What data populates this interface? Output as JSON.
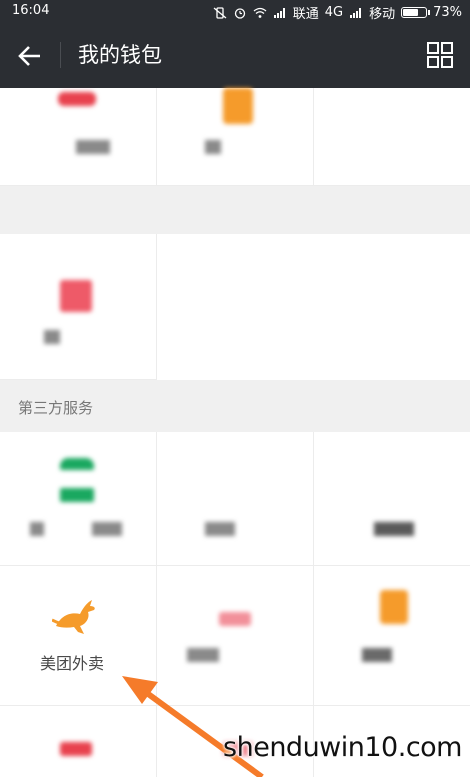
{
  "status_bar": {
    "time": "16:04",
    "carrier_1": "联通",
    "network_type": "4G",
    "carrier_2": "移动",
    "battery_percent": "73%",
    "battery_level": 0.73
  },
  "header": {
    "title": "我的钱包"
  },
  "sections": {
    "third_party_title": "第三方服务"
  },
  "services": {
    "meituan_label": "美团外卖"
  },
  "watermark": {
    "text": "shenduwin10.com"
  },
  "colors": {
    "header_bg": "#2b2e33",
    "page_bg": "#f0f0f0",
    "accent_orange": "#f59b2b",
    "arrow_orange": "#f57b2a"
  }
}
